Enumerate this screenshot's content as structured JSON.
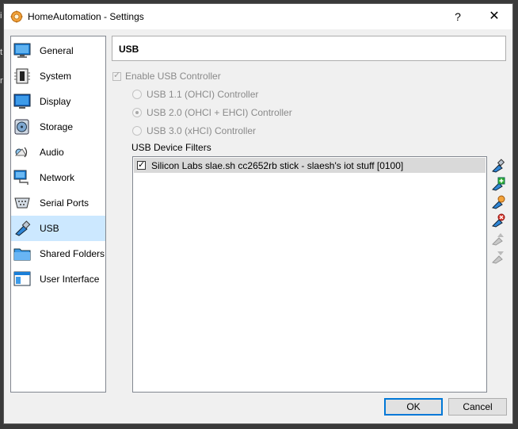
{
  "window": {
    "title": "HomeAutomation - Settings",
    "help_label": "?",
    "close_label": "✕"
  },
  "sidebar": {
    "items": [
      {
        "label": "General",
        "icon": "general-icon"
      },
      {
        "label": "System",
        "icon": "system-icon"
      },
      {
        "label": "Display",
        "icon": "display-icon"
      },
      {
        "label": "Storage",
        "icon": "storage-icon"
      },
      {
        "label": "Audio",
        "icon": "audio-icon"
      },
      {
        "label": "Network",
        "icon": "network-icon"
      },
      {
        "label": "Serial Ports",
        "icon": "serial-ports-icon"
      },
      {
        "label": "USB",
        "icon": "usb-icon",
        "selected": true
      },
      {
        "label": "Shared Folders",
        "icon": "shared-folders-icon"
      },
      {
        "label": "User Interface",
        "icon": "user-interface-icon"
      }
    ]
  },
  "page": {
    "title": "USB",
    "enable_usb_label": "Enable USB Controller",
    "enable_usb_checked": true,
    "controllers": [
      {
        "label": "USB 1.1 (OHCI) Controller",
        "selected": false
      },
      {
        "label": "USB 2.0 (OHCI + EHCI) Controller",
        "selected": true
      },
      {
        "label": "USB 3.0 (xHCI) Controller",
        "selected": false
      }
    ],
    "filters_label": "USB Device Filters",
    "filters": [
      {
        "label": "Silicon Labs slae.sh cc2652rb stick - slaesh's iot stuff [0100]",
        "checked": true
      }
    ]
  },
  "toolbar": {
    "tools": [
      "add-empty-filter-icon",
      "add-filter-from-device-icon",
      "edit-filter-icon",
      "remove-filter-icon",
      "move-filter-up-icon",
      "move-filter-down-icon"
    ]
  },
  "buttons": {
    "ok_label": "OK",
    "cancel_label": "Cancel"
  }
}
